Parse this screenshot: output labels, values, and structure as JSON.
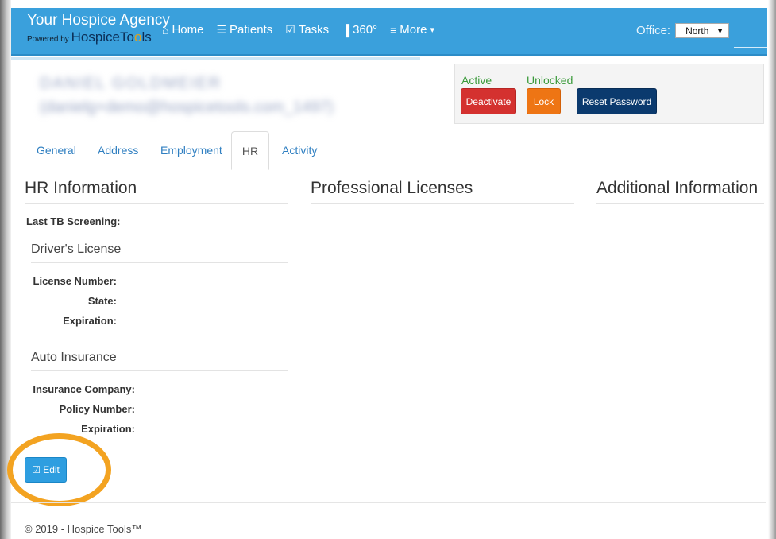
{
  "brand": {
    "title": "Your Hospice Agency",
    "powered_by": "Powered by",
    "name_main": "HospiceTo",
    "name_accent": "o",
    "name_tail": "ls"
  },
  "nav": {
    "items": [
      {
        "label": "Home",
        "icon": "home-icon",
        "glyph": "⌂"
      },
      {
        "label": "Patients",
        "icon": "list-icon",
        "glyph": "☰"
      },
      {
        "label": "Tasks",
        "icon": "checkbox-icon",
        "glyph": "☑"
      },
      {
        "label": "360°",
        "icon": "bar-chart-icon",
        "glyph": "▐"
      },
      {
        "label": "More",
        "icon": "menu-icon",
        "glyph": "≡",
        "caret": "▾"
      }
    ],
    "office_label": "Office:",
    "office_value": "North",
    "office_caret": "▼"
  },
  "user": {
    "name": "DANIEL GOLDMEIER",
    "email": "(danielg+demo@hospicetools.com_1497)"
  },
  "status": {
    "active_label": "Active",
    "lock_state_label": "Unlocked",
    "deactivate_button": "Deactivate",
    "lock_button": "Lock",
    "reset_password_button": "Reset Password"
  },
  "tabs": [
    "General",
    "Address",
    "Employment",
    "HR",
    "Activity"
  ],
  "active_tab": "HR",
  "sections": {
    "hr_information": "HR Information",
    "professional_licenses": "Professional Licenses",
    "additional_information": "Additional Information"
  },
  "hr": {
    "last_tb_label": "Last TB Screening:",
    "drivers_license_title": "Driver's License",
    "license_number_label": "License Number:",
    "state_label": "State:",
    "license_expiration_label": "Expiration:",
    "auto_insurance_title": "Auto Insurance",
    "insurance_company_label": "Insurance Company:",
    "policy_number_label": "Policy Number:",
    "insurance_expiration_label": "Expiration:"
  },
  "edit_button": {
    "glyph": "☑",
    "label": "Edit"
  },
  "colors": {
    "navbar": "#3aa0dc",
    "deactivate": "#d4312f",
    "lock": "#ee7514",
    "reset_password": "#0b3a6e",
    "highlight_ring": "#f3a321"
  },
  "footer": "© 2019 - Hospice Tools™"
}
